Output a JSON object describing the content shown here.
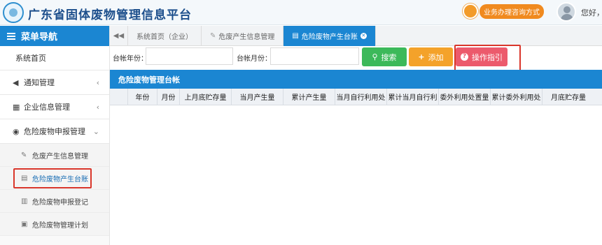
{
  "header": {
    "title": "广东省固体废物管理信息平台",
    "consult_label": "业务办理咨询方式",
    "greeting": "您好，"
  },
  "sidebar": {
    "menu_title": "菜单导航",
    "items": [
      {
        "label": "系统首页"
      },
      {
        "label": "通知管理"
      },
      {
        "label": "企业信息管理"
      },
      {
        "label": "危险废物申报管理"
      }
    ],
    "sub_items": [
      {
        "label": "危废产生信息管理"
      },
      {
        "label": "危险废物产生台账"
      },
      {
        "label": "危险废物申报登记"
      },
      {
        "label": "危险废物管理计划"
      }
    ]
  },
  "tabs": [
    {
      "label": "系统首页（企业）"
    },
    {
      "label": "危废产生信息管理"
    },
    {
      "label": "危险废物产生台账"
    }
  ],
  "search": {
    "year_label": "台帐年份：",
    "year_value": "",
    "month_label": "台帐月份：",
    "month_value": "",
    "search_button": "搜索",
    "add_button": "添加",
    "guide_button": "操作指引"
  },
  "panel": {
    "title": "危险废物管理台帐"
  },
  "table": {
    "columns": [
      "年份",
      "月份",
      "上月底贮存量",
      "当月产生量",
      "累计产生量",
      "当月自行利用处",
      "累计当月自行利",
      "委外利用处置量",
      "累计委外利用处",
      "月底贮存量"
    ]
  },
  "colors": {
    "primary": "#1b86d2",
    "search": "#3cb95a",
    "add": "#f4a22a",
    "guide": "#ec5a6c",
    "highlight": "#d9362b"
  }
}
